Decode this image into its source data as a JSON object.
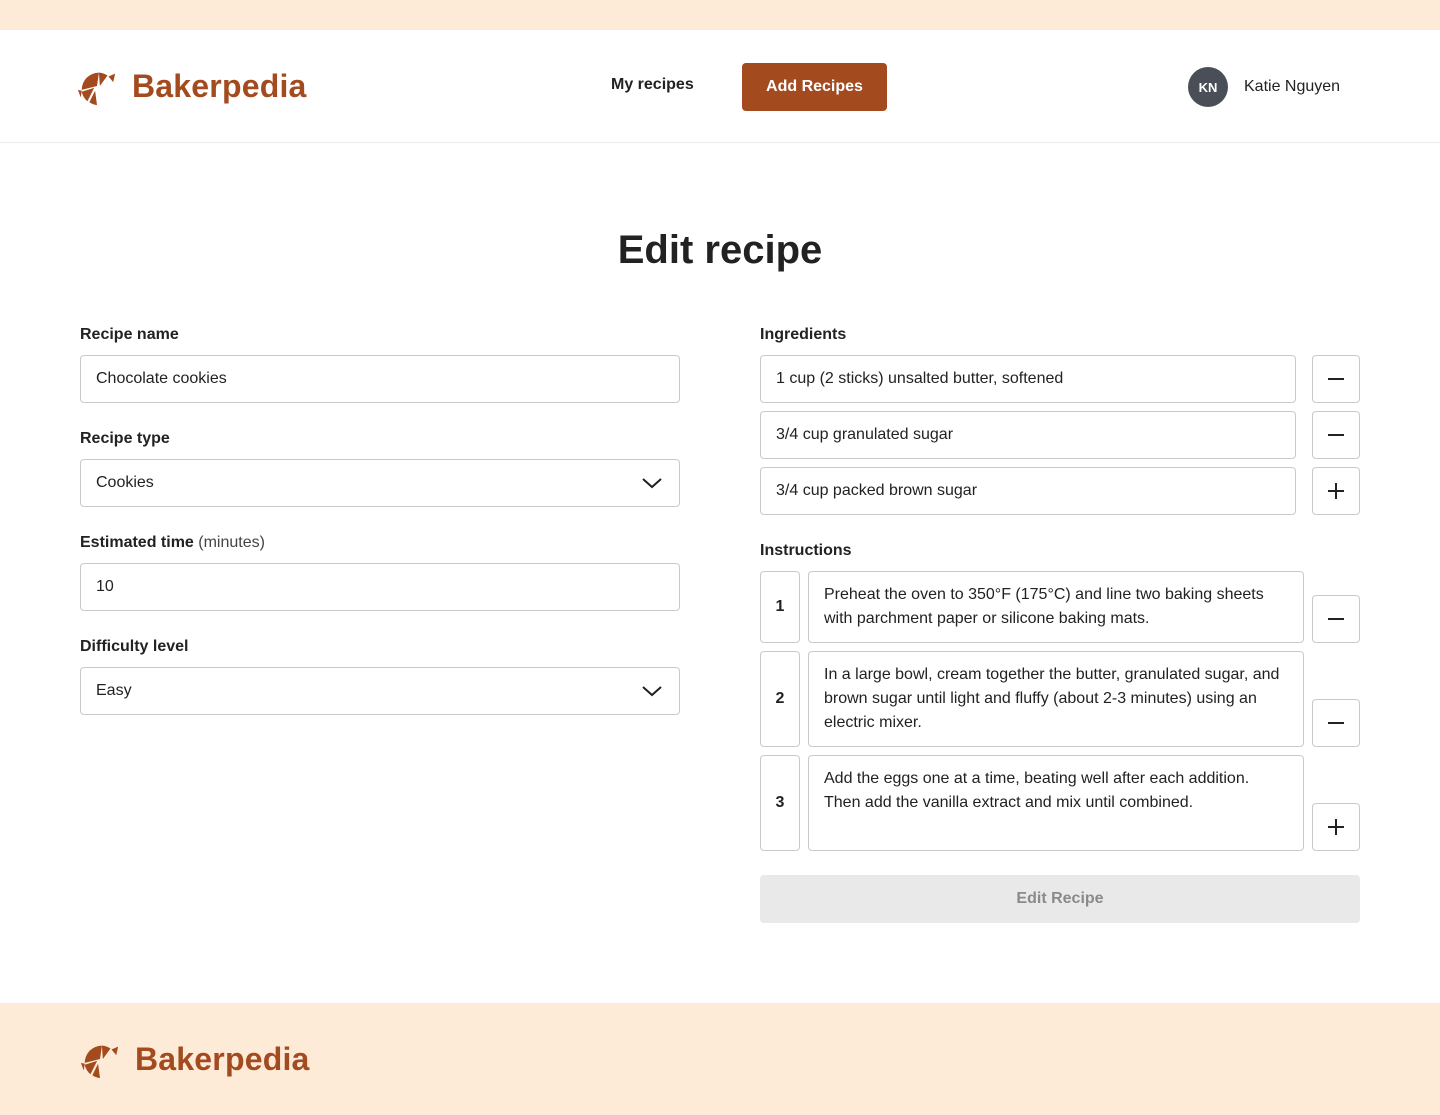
{
  "app": {
    "brand": "Bakerpedia",
    "brand_color": "#a34a1f",
    "logo_icon": "croissant-icon"
  },
  "header": {
    "nav_my_recipes": "My recipes",
    "nav_add_recipes": "Add Recipes",
    "user": {
      "initials": "KN",
      "name": "Katie Nguyen"
    }
  },
  "page": {
    "title": "Edit recipe"
  },
  "form": {
    "recipe_name": {
      "label": "Recipe name",
      "value": "Chocolate cookies"
    },
    "recipe_type": {
      "label": "Recipe type",
      "value": "Cookies",
      "icon": "chevron-down-icon"
    },
    "estimated_time": {
      "label": "Estimated time",
      "label_suffix": "(minutes)",
      "value": "10"
    },
    "difficulty": {
      "label": "Difficulty level",
      "value": "Easy",
      "icon": "chevron-down-icon"
    }
  },
  "ingredients": {
    "label": "Ingredients",
    "items": [
      {
        "value": "1 cup (2 sticks) unsalted butter, softened",
        "action": "minus-icon"
      },
      {
        "value": "3/4 cup granulated sugar",
        "action": "minus-icon"
      },
      {
        "value": "3/4 cup packed brown sugar",
        "action": "plus-icon"
      }
    ]
  },
  "instructions": {
    "label": "Instructions",
    "steps": [
      {
        "number": "1",
        "text": "Preheat the oven to 350°F (175°C) and line two baking sheets with parchment paper or silicone baking mats.",
        "action": "minus-icon"
      },
      {
        "number": "2",
        "text": "In a large bowl, cream together the butter, granulated sugar, and brown sugar until light and fluffy (about 2-3 minutes) using an electric mixer.",
        "action": "minus-icon"
      },
      {
        "number": "3",
        "text": "Add the eggs one at a time, beating well after each addition. Then add the vanilla extract and mix until combined.",
        "action": "plus-icon"
      }
    ]
  },
  "submit": {
    "label": "Edit Recipe",
    "disabled": true
  },
  "footer": {
    "brand": "Bakerpedia"
  }
}
